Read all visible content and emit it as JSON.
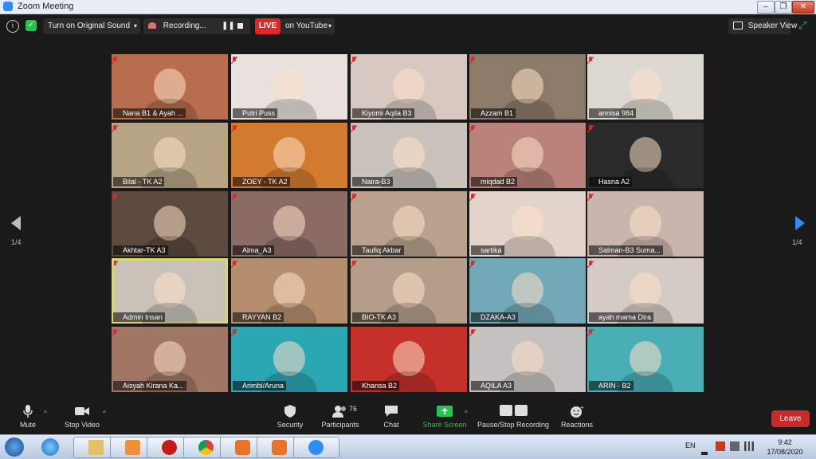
{
  "window": {
    "title": "Zoom Meeting"
  },
  "topbar": {
    "original_sound_label": "Turn on Original Sound",
    "recording_label": "Recording...",
    "live_label": "LIVE",
    "live_target_label": "on YouTube",
    "speaker_view_label": "Speaker View"
  },
  "grid": {
    "tiles": [
      {
        "name": "Nana B1 & Ayah ...",
        "bg": "#b86d4e"
      },
      {
        "name": "Putri Puss",
        "bg": "#e8e1dd"
      },
      {
        "name": "Kiyomi Aqila B3",
        "bg": "#d7c8c1"
      },
      {
        "name": "Azzam B1",
        "bg": "#8d7b6a"
      },
      {
        "name": "annisa 984",
        "bg": "#ddd8d2"
      },
      {
        "name": "Bilal - TK A2",
        "bg": "#b7a485"
      },
      {
        "name": "ZOEY - TK A2",
        "bg": "#d37b2e"
      },
      {
        "name": "Naira-B3",
        "bg": "#c9c3bb"
      },
      {
        "name": "miqdad B2",
        "bg": "#b9827b"
      },
      {
        "name": "Hasna A2",
        "bg": "#2a2a2a"
      },
      {
        "name": "Akhtar-TK A3",
        "bg": "#5b4a3d"
      },
      {
        "name": "Alma_A3",
        "bg": "#8b6c64"
      },
      {
        "name": "Taufiq Akbar",
        "bg": "#b9a28d"
      },
      {
        "name": "sartika",
        "bg": "#e3d4cb"
      },
      {
        "name": "Salman-B3 Suma...",
        "bg": "#c8b6ad"
      },
      {
        "name": "Admin Insan",
        "bg": "#c9c2b9"
      },
      {
        "name": "RAYYAN B2",
        "bg": "#b58f6d"
      },
      {
        "name": "BIO-TK A3",
        "bg": "#b59f8b"
      },
      {
        "name": "DZAKA-A3",
        "bg": "#72a9b6"
      },
      {
        "name": "ayah mama Dira",
        "bg": "#d5cbc5"
      },
      {
        "name": "Aisyah Kirana Ka...",
        "bg": "#a07764"
      },
      {
        "name": "Arimbi/Aruna",
        "bg": "#2ba7b4"
      },
      {
        "name": "Khansa B2",
        "bg": "#c5302b"
      },
      {
        "name": "AQILA A3",
        "bg": "#c4c2bf"
      },
      {
        "name": "ARIN - B2",
        "bg": "#49aeb5"
      }
    ],
    "active_index": 15
  },
  "pagination": {
    "left_label": "1/4",
    "right_label": "1/4"
  },
  "controls": {
    "mute": "Mute",
    "stop_video": "Stop Video",
    "security": "Security",
    "participants": "Participants",
    "participants_count": "76",
    "chat": "Chat",
    "share_screen": "Share Screen",
    "pause_stop_recording": "Pause/Stop Recording",
    "reactions": "Reactions",
    "leave": "Leave"
  },
  "taskbar": {
    "lang": "EN",
    "time": "9:42",
    "date": "17/08/2020"
  },
  "colors": {
    "accent": "#2d8cff",
    "live": "#e02828",
    "share": "#23c551",
    "leave": "#c82a2a",
    "active_border": "#d9d96a"
  }
}
